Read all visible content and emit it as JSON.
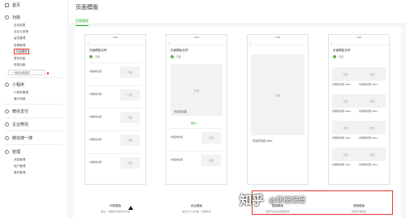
{
  "sidebar": {
    "home": "首页",
    "sections": [
      {
        "title": "功能",
        "items": [
          "自动回复",
          "自定义菜单",
          "留言管理",
          "投票管理",
          "页面模版",
          "原创功能",
          "赞赏功能"
        ],
        "active_index": 4
      },
      {
        "title": "小程序",
        "items": [
          "小程序管理",
          "展示场景"
        ]
      },
      {
        "title": "微信支付",
        "items": []
      },
      {
        "title": "企业微信",
        "items": []
      },
      {
        "title": "微信搜一搜",
        "items": []
      },
      {
        "title": "管理",
        "items": [
          "消息管理",
          "用户管理",
          "素材管理"
        ]
      }
    ],
    "add_plugin": "+ 添加功能插件"
  },
  "page": {
    "title": "页面模版",
    "tab": "页面模版"
  },
  "phone": {
    "time": "1:21",
    "back": "‹",
    "page_name": "页面模板名称",
    "author": "页面",
    "cover": "封面",
    "row_title": "内容的标题",
    "row_title_video": "内容的标题 video",
    "cover_title": "内容的标题",
    "more": "更多 >"
  },
  "cards": [
    {
      "name": "列表模版",
      "desc": "适合，视图或内容列表方案",
      "button": "选择"
    },
    {
      "name": "综合模版",
      "desc": "适合大尺寸封面，合理布局",
      "button": "选择"
    },
    {
      "name": "视频模版",
      "desc": "视频可在此内容模版中",
      "button": "选择"
    },
    {
      "name": "视频模版",
      "desc": "视频标准模版",
      "button": "选择"
    }
  ],
  "watermark": {
    "logo": "知乎",
    "text": "@新榜编辑"
  }
}
